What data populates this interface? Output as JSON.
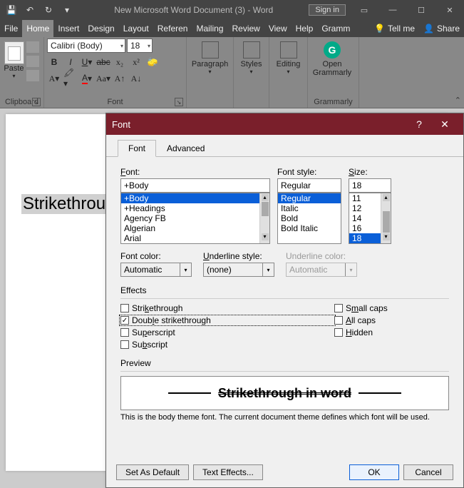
{
  "titlebar": {
    "doc_title": "New Microsoft Word Document (3) - Word",
    "signin": "Sign in"
  },
  "tabs": {
    "file": "File",
    "home": "Home",
    "insert": "Insert",
    "design": "Design",
    "layout": "Layout",
    "references": "Referen",
    "mailings": "Mailing",
    "review": "Review",
    "view": "View",
    "help": "Help",
    "grammarly": "Gramm",
    "tellme": "Tell me",
    "share": "Share"
  },
  "ribbon": {
    "clipboard_label": "Clipboard",
    "paste": "Paste",
    "font_label": "Font",
    "font_name": "Calibri (Body)",
    "font_size": "18",
    "paragraph": "Paragraph",
    "styles": "Styles",
    "editing": "Editing",
    "open_grammarly": "Open Grammarly",
    "grammarly_group": "Grammarly"
  },
  "document": {
    "selected_text": "Strikethrou"
  },
  "dialog": {
    "title": "Font",
    "tab_font": "Font",
    "tab_advanced": "Advanced",
    "font_label": "Font:",
    "font_value": "+Body",
    "style_label": "Font style:",
    "style_value": "Regular",
    "size_label": "Size:",
    "size_value": "18",
    "font_list": [
      "+Body",
      "+Headings",
      "Agency FB",
      "Algerian",
      "Arial"
    ],
    "style_list": [
      "Regular",
      "Italic",
      "Bold",
      "Bold Italic"
    ],
    "size_list": [
      "11",
      "12",
      "14",
      "16",
      "18"
    ],
    "fontcolor_label": "Font color:",
    "fontcolor_value": "Automatic",
    "under_label": "Underline style:",
    "under_value": "(none)",
    "undercolor_label": "Underline color:",
    "undercolor_value": "Automatic",
    "effects_label": "Effects",
    "eff_strike": "Strikethrough",
    "eff_dblstrike": "Double strikethrough",
    "eff_super": "Superscript",
    "eff_sub": "Subscript",
    "eff_smallcaps": "Small caps",
    "eff_allcaps": "All caps",
    "eff_hidden": "Hidden",
    "preview_label": "Preview",
    "preview_text": "Strikethrough in word",
    "preview_note": "This is the body theme font. The current document theme defines which font will be used.",
    "set_default": "Set As Default",
    "text_effects": "Text Effects...",
    "ok": "OK",
    "cancel": "Cancel"
  }
}
